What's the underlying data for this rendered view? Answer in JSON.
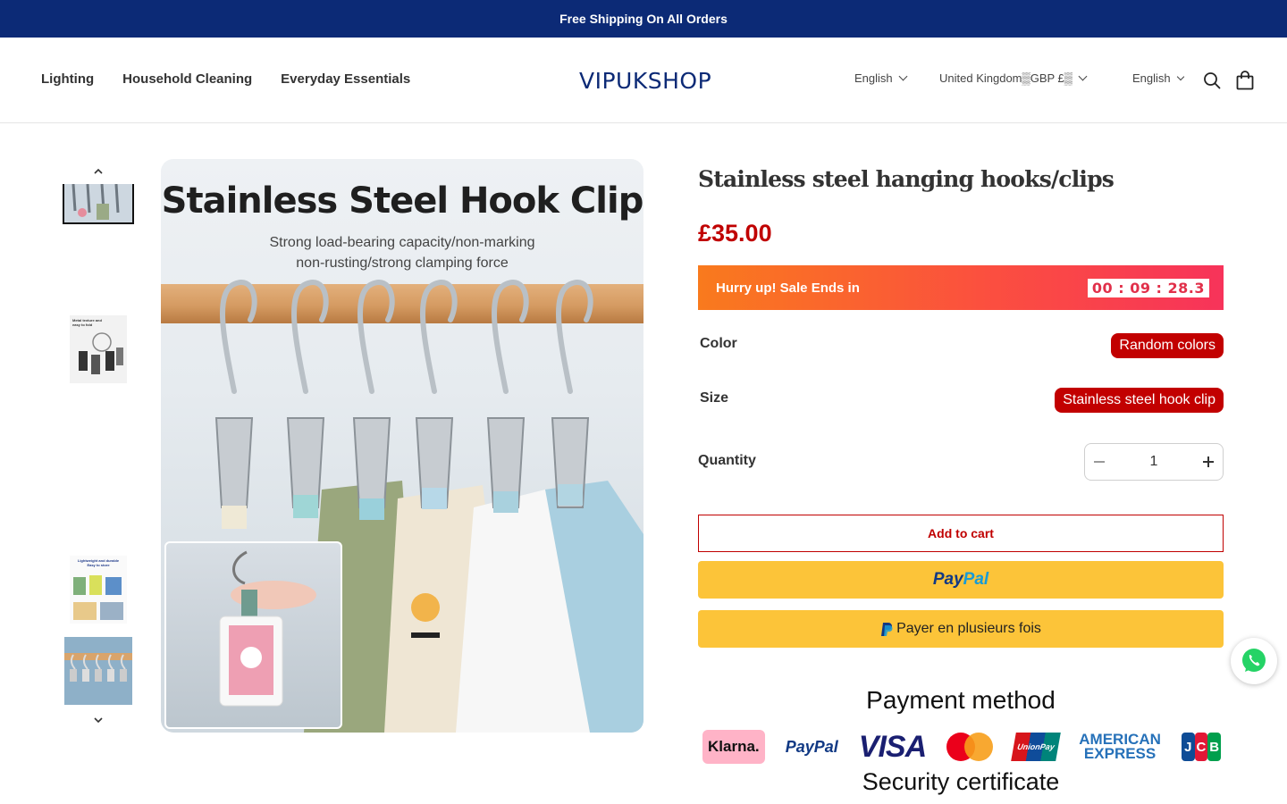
{
  "announcement": "Free Shipping On All Orders",
  "header": {
    "nav": [
      "Lighting",
      "Household Cleaning",
      "Everyday Essentials"
    ],
    "logo": "VIPUKSHOP",
    "language": "English",
    "country": "United Kingdom▒GBP £▒",
    "language2": "English"
  },
  "gallery": {
    "image_title": "Stainless Steel Hook Clip",
    "image_subtitle_line1": "Strong load-bearing capacity/non-marking",
    "image_subtitle_line2": "non-rusting/strong clamping force",
    "thumb2_text": "Metal texture and easy to fold",
    "thumb3_text": "Lightweight and durable Easy to store"
  },
  "product": {
    "title": "Stainless steel hanging hooks/clips",
    "price": "£35.00",
    "sale_text": "Hurry up! Sale Ends in",
    "timer": "00 : 09 : 28.3",
    "color_label": "Color",
    "color_value": "Random colors",
    "size_label": "Size",
    "size_value": "Stainless steel hook clip",
    "quantity_label": "Quantity",
    "quantity_value": "1",
    "add_to_cart": "Add to cart",
    "paypal_1": "Pay",
    "paypal_2": "Pal",
    "payer": "Payer en plusieurs fois"
  },
  "payment": {
    "title": "Payment method",
    "klarna": "Klarna.",
    "paypal": "PayPal",
    "visa": "VISA",
    "unionpay": "UnionPay",
    "amex_1": "AMERICAN",
    "amex_2": "EXPRESS",
    "jcb": [
      "J",
      "C",
      "B"
    ],
    "security": "Security certificate"
  },
  "colors": {
    "announcement_bg": "#0c2a76",
    "price": "#c00000",
    "pill": "#c20000",
    "paypal_yellow": "#fcc439",
    "whatsapp": "#25d366"
  }
}
